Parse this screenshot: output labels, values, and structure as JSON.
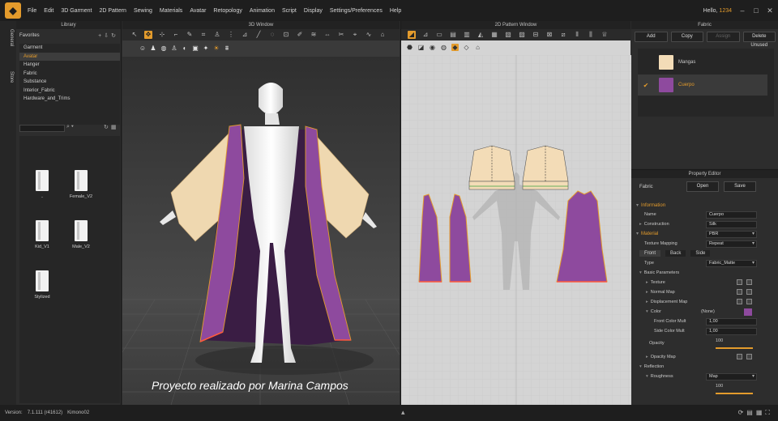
{
  "menu": {
    "items": [
      "File",
      "Edit",
      "3D Garment",
      "2D Pattern",
      "Sewing",
      "Materials",
      "Avatar",
      "Retopology",
      "Animation",
      "Script",
      "Display",
      "Settings/Preferences",
      "Help"
    ],
    "greeting": "Hello,",
    "user": "1234"
  },
  "side_tabs": [
    "General",
    "Store"
  ],
  "library": {
    "title": "Library",
    "favorites_label": "Favorites",
    "favorites": [
      "Garment",
      "Avatar",
      "Hanger",
      "Fabric",
      "Substance",
      "Interior_Fabric",
      "Hardware_and_Trims"
    ],
    "selected_favorite": "Avatar",
    "files": [
      {
        "name": ".."
      },
      {
        "name": "Female_V2"
      },
      {
        "name": "Kid_V1"
      },
      {
        "name": "Male_V2"
      },
      {
        "name": "Stylized"
      }
    ]
  },
  "window3d": {
    "title": "3D Window",
    "caption": "Proyecto realizado por Marina Campos"
  },
  "window2d": {
    "title": "2D Pattern Window"
  },
  "fabric": {
    "title": "Fabric",
    "buttons": {
      "add": "Add",
      "copy": "Copy",
      "assign": "Assign",
      "delete_unused": "Delete Unused"
    },
    "items": [
      {
        "name": "Mangas",
        "color": "#f3dcb7",
        "selected": false
      },
      {
        "name": "Cuerpo",
        "color": "#8e4a9e",
        "selected": true
      }
    ]
  },
  "property_editor": {
    "title": "Property Editor",
    "object": "Fabric",
    "open_label": "Open",
    "save_label": "Save",
    "information_label": "Information",
    "name_label": "Name",
    "name_value": "Cuerpo",
    "construction_label": "Construction",
    "construction_value": "Silk",
    "material_label": "Material",
    "material_value": "PBR",
    "texture_mapping_label": "Texture Mapping",
    "texture_mapping_value": "Repeat",
    "tabs": [
      "Front",
      "Back",
      "Side"
    ],
    "type_label": "Type",
    "type_value": "Fabric_Matte",
    "basic_parameters_label": "Basic Parameters",
    "texture_label": "Texture",
    "normal_map_label": "Normal Map",
    "displacement_map_label": "Displacement Map",
    "color_label": "Color",
    "color_value": "(None)",
    "color_swatch": "#8e4a9e",
    "front_color_mult_label": "Front Color Mult",
    "front_color_mult_value": "1,00",
    "side_color_mult_label": "Side Color Mult",
    "side_color_mult_value": "1,00",
    "opacity_label": "Opacity",
    "opacity_value": "100",
    "opacity_map_label": "Opacity Map",
    "reflection_label": "Reflection",
    "roughness_label": "Roughness",
    "roughness_value": "Map",
    "roughness_amount": "100"
  },
  "status": {
    "version_label": "Version:",
    "version_value": "7.1.111 (r41612)",
    "file_name": "Kimono02"
  },
  "colors": {
    "accent": "#e39b2c",
    "purple": "#8e4a9e",
    "cream": "#f3dcb7"
  }
}
